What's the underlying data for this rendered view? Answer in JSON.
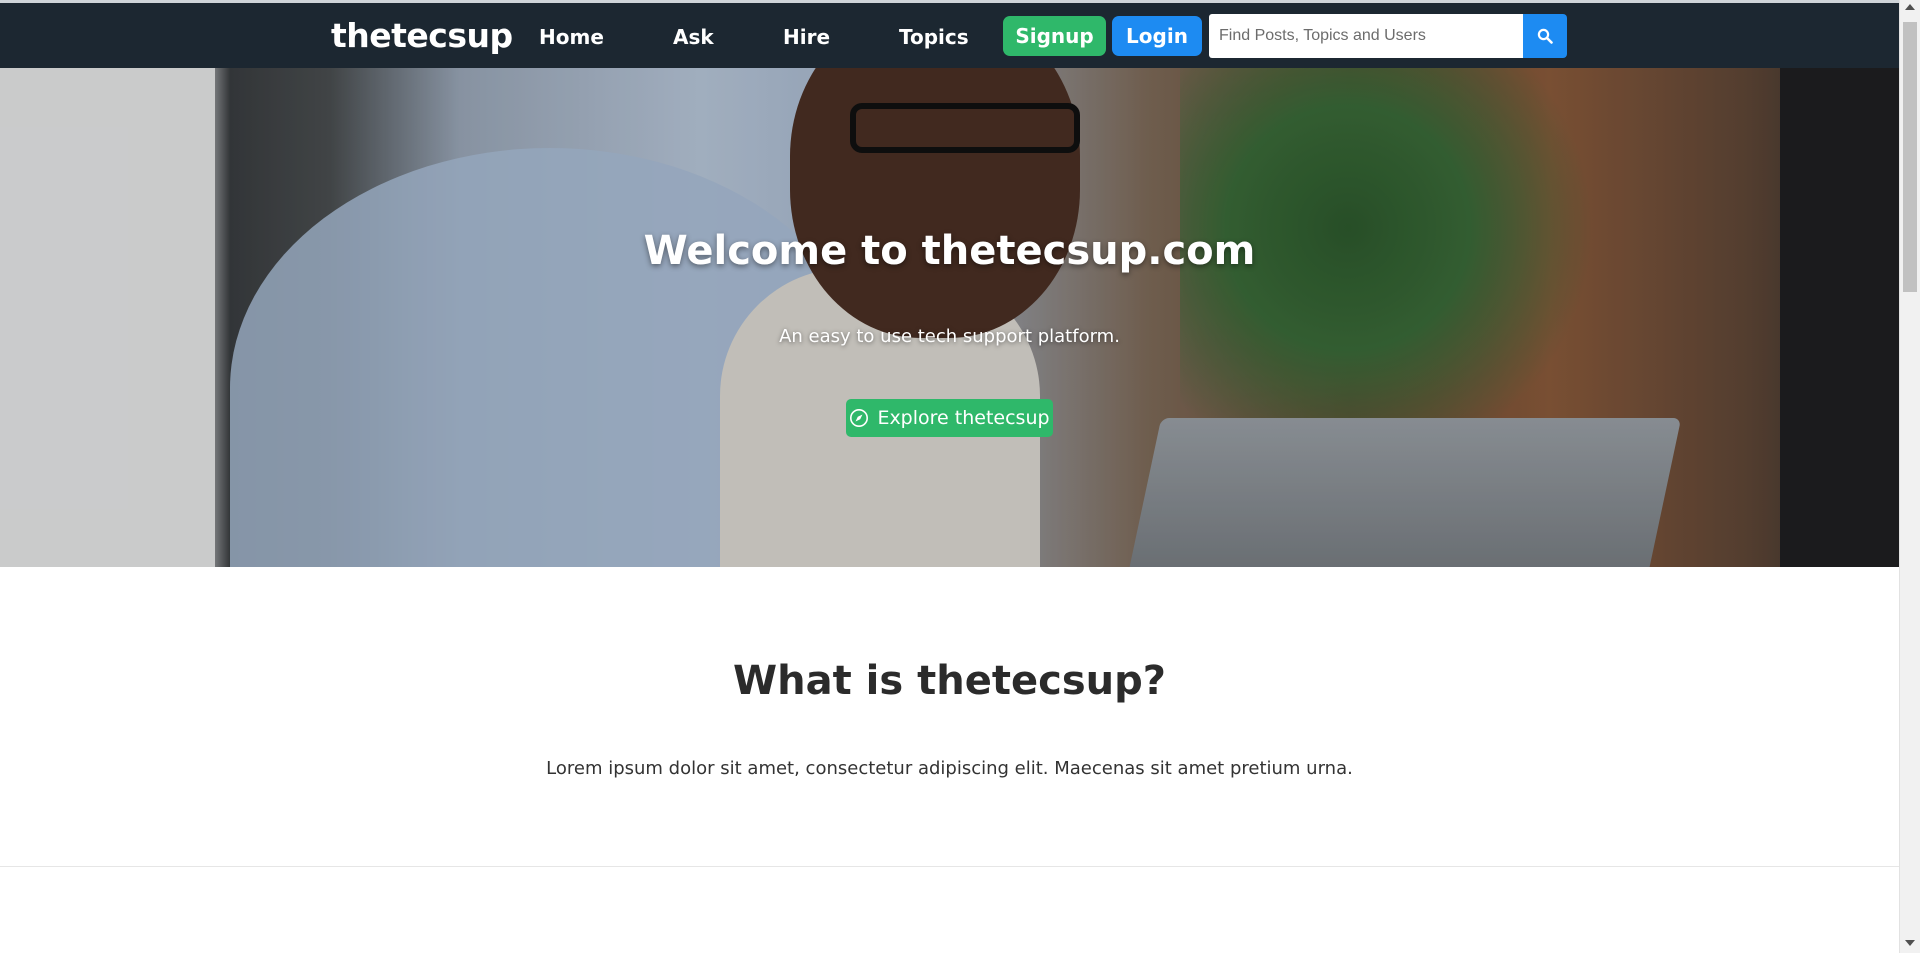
{
  "navbar": {
    "brand": "thetecsup",
    "links": [
      "Home",
      "Ask",
      "Hire",
      "Topics"
    ],
    "signup_label": "Signup",
    "login_label": "Login",
    "search_placeholder": "Find Posts, Topics and Users",
    "search_value": "",
    "search_icon": "search-icon",
    "colors": {
      "background": "#1c2731",
      "signup": "#2fb86a",
      "login": "#1d8bf2"
    }
  },
  "hero": {
    "title": "Welcome to thetecsup.com",
    "subtitle": "An easy to use tech support platform.",
    "explore_label": "Explore thetecsup",
    "explore_icon": "compass-icon"
  },
  "about": {
    "title": "What is thetecsup?",
    "text": "Lorem ipsum dolor sit amet, consectetur adipiscing elit. Maecenas sit amet pretium urna."
  }
}
